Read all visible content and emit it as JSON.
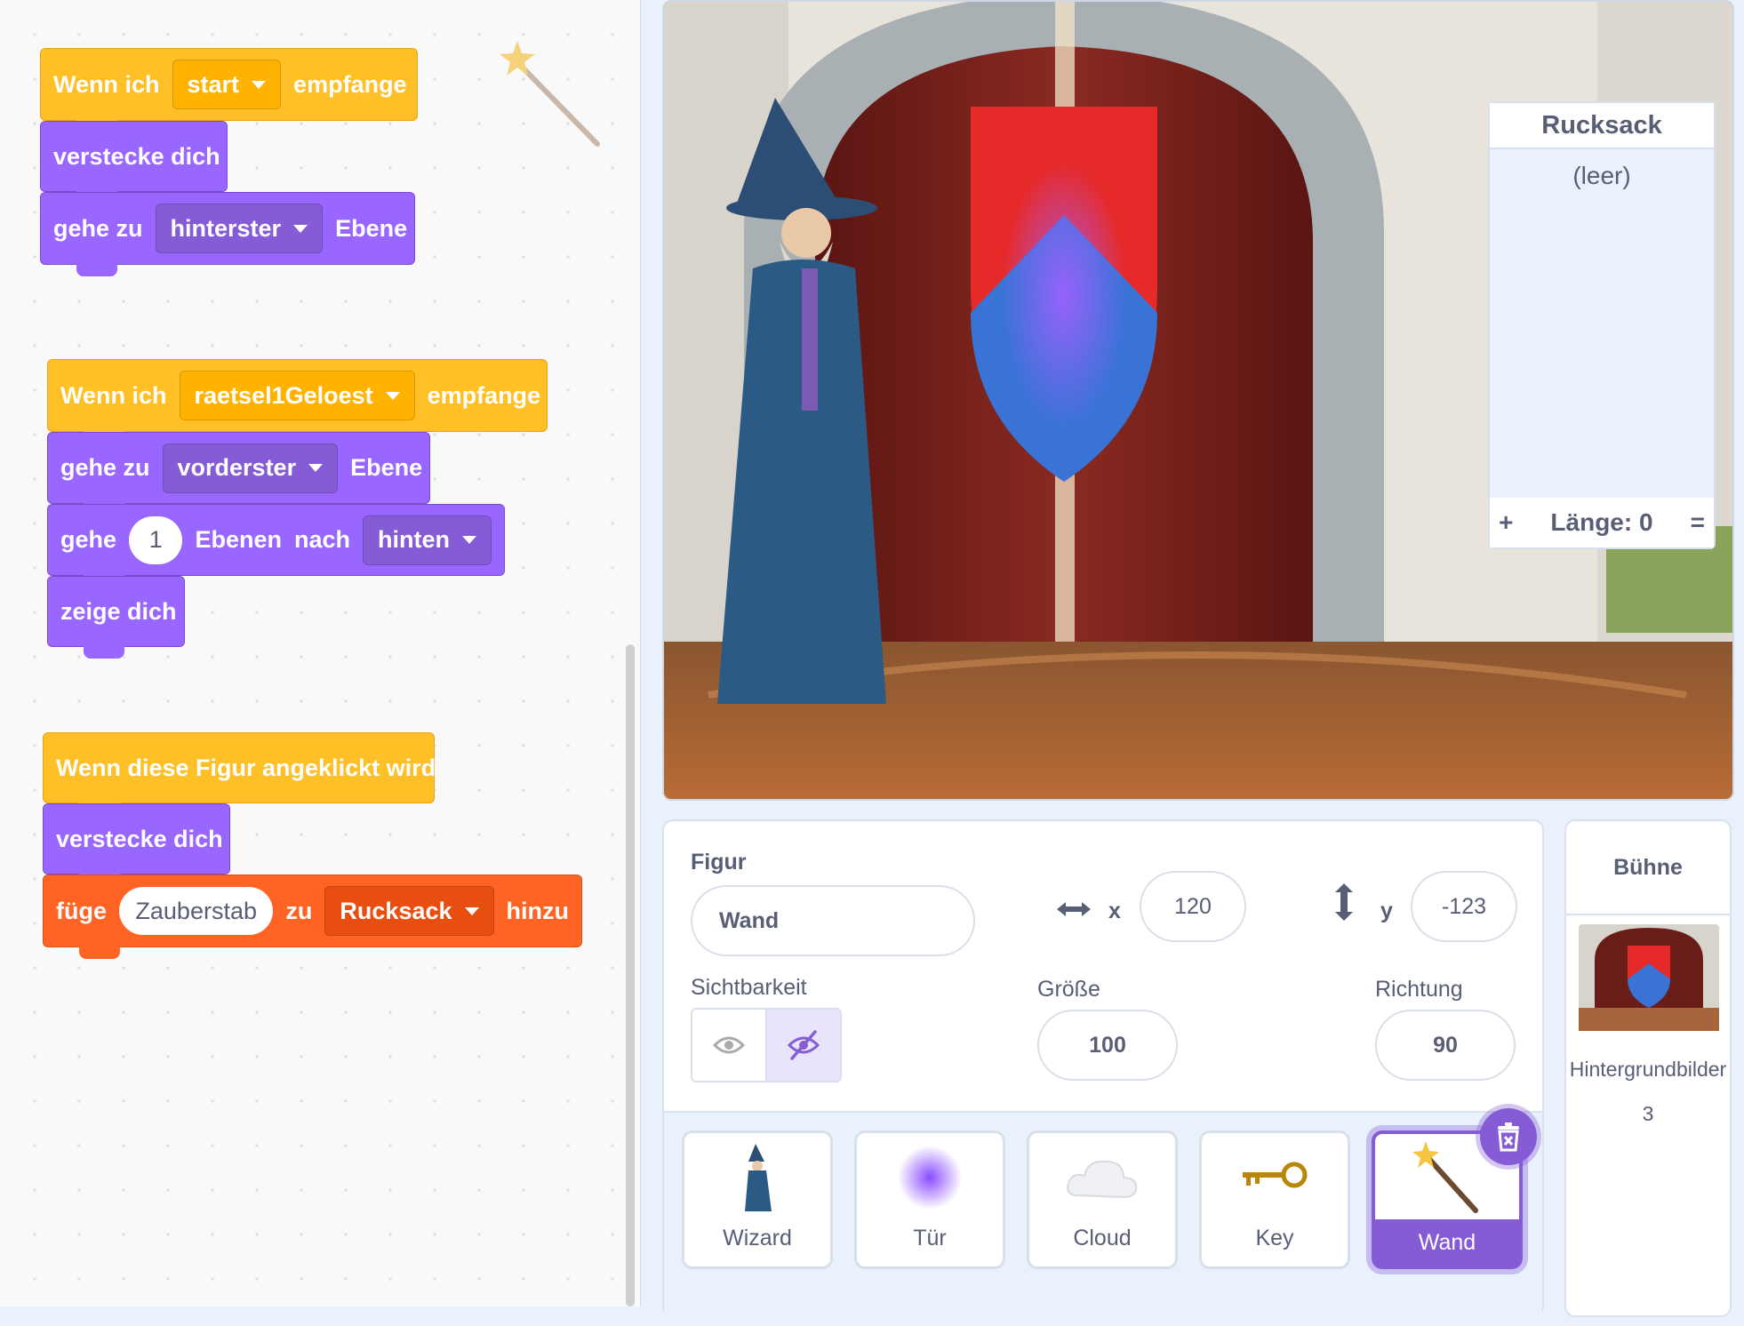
{
  "scripts": [
    {
      "hat": {
        "prefix": "Wenn ich",
        "dropdown": "start",
        "suffix": "empfange"
      },
      "blocks": [
        {
          "text": "verstecke dich"
        },
        {
          "prefix": "gehe zu",
          "dropdown": "hinterster",
          "suffix": "Ebene"
        }
      ]
    },
    {
      "hat": {
        "prefix": "Wenn ich",
        "dropdown": "raetsel1Geloest",
        "suffix": "empfange"
      },
      "blocks": [
        {
          "prefix": "gehe zu",
          "dropdown": "vorderster",
          "suffix": "Ebene"
        },
        {
          "prefix": "gehe",
          "input": "1",
          "middle1": "Ebenen",
          "middle2": "nach",
          "dropdown": "hinten"
        },
        {
          "text": "zeige dich"
        }
      ]
    },
    {
      "hat": {
        "text": "Wenn diese Figur angeklickt wird"
      },
      "blocks": [
        {
          "text": "verstecke dich"
        },
        {
          "prefix": "füge",
          "input": "Zauberstab",
          "middle": "zu",
          "dropdown": "Rucksack",
          "suffix": "hinzu"
        }
      ]
    }
  ],
  "backpack": {
    "title": "Rucksack",
    "empty": "(leer)",
    "add": "+",
    "length": "Länge: 0",
    "eq": "="
  },
  "sprite": {
    "label": "Figur",
    "name": "Wand",
    "x_label": "x",
    "x": "120",
    "y_label": "y",
    "y": "-123",
    "visibility_label": "Sichtbarkeit",
    "size_label": "Größe",
    "size": "100",
    "direction_label": "Richtung",
    "direction": "90"
  },
  "sprites": [
    {
      "name": "Wizard",
      "icon": "wizard-icon"
    },
    {
      "name": "Tür",
      "icon": "glow-icon"
    },
    {
      "name": "Cloud",
      "icon": "cloud-icon"
    },
    {
      "name": "Key",
      "icon": "key-icon"
    },
    {
      "name": "Wand",
      "icon": "wand-icon",
      "selected": true
    }
  ],
  "stage_pane": {
    "title": "Bühne",
    "backdrops_label": "Hintergrundbilder",
    "backdrops_count": "3"
  },
  "colors": {
    "events": "#ffbf26",
    "looks": "#9966ff",
    "custom": "#ff6424",
    "accent": "#855cd6"
  }
}
